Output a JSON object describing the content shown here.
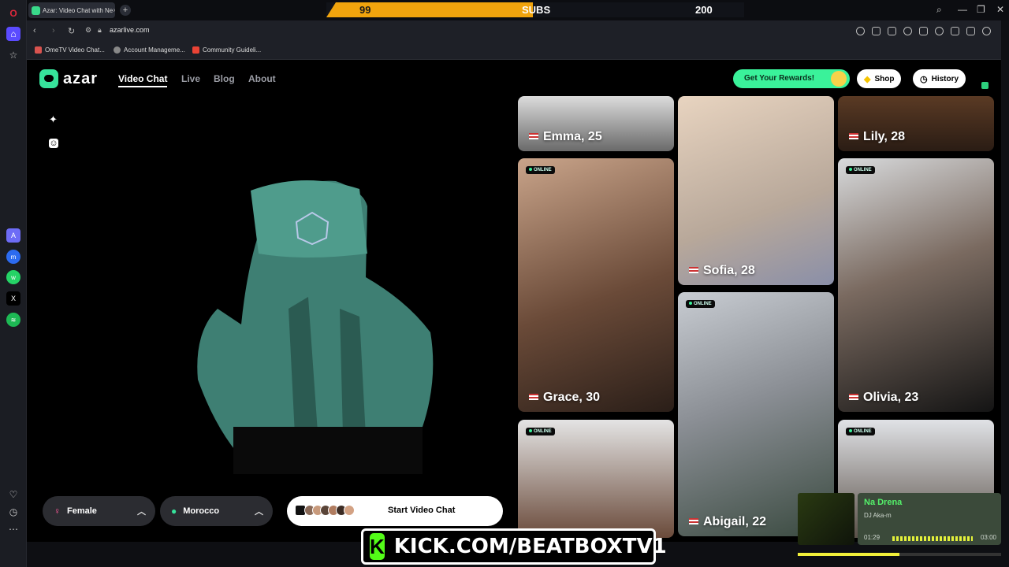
{
  "browser": {
    "tab_title": "Azar: Video Chat with Ne",
    "url": "azarlive.com",
    "bookmarks": [
      "OmeTV Video Chat...",
      "Account Manageme...",
      "Community Guideli..."
    ]
  },
  "stream_overlay": {
    "subs_current": "99",
    "subs_label": "SUBS",
    "subs_goal": "200",
    "subs_fill_fraction": 0.495,
    "kick_url": "KICK.COM/BEATBOXTV1",
    "kick_logo_letter": "K"
  },
  "music": {
    "song": "Na Drena",
    "artist": "DJ Aka-m",
    "elapsed": "01:29",
    "duration": "03:00",
    "progress_fraction": 0.5
  },
  "site": {
    "logo": "azar",
    "nav": [
      "Video Chat",
      "Live",
      "Blog",
      "About"
    ],
    "rewards_label": "Get Your Rewards!",
    "shop_label": "Shop",
    "history_label": "History",
    "gender_filter": "Female",
    "region_filter": "Morocco",
    "start_label": "Start Video Chat",
    "online_badge": "ONLINE"
  },
  "profiles": [
    {
      "name": "Emma, 25"
    },
    {
      "name": "Sofia, 28"
    },
    {
      "name": "Lily, 28"
    },
    {
      "name": "Grace, 30"
    },
    {
      "name": "Abigail, 22"
    },
    {
      "name": "Olivia, 23"
    }
  ]
}
